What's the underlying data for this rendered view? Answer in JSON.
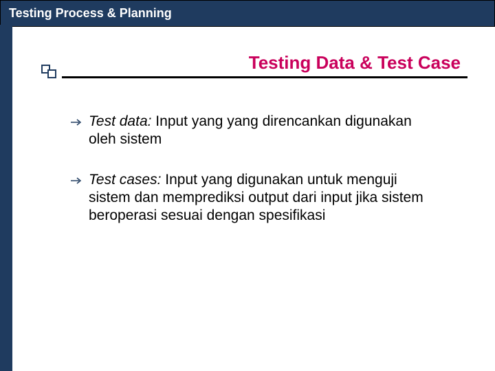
{
  "header": {
    "title": "Testing Process & Planning"
  },
  "section": {
    "title": "Testing Data & Test Case"
  },
  "bullets": [
    {
      "term": "Test data:",
      "body": "  Input yang yang direncankan digunakan oleh sistem"
    },
    {
      "term": "Test cases:",
      "body": "  Input yang digunakan untuk menguji sistem dan memprediksi output dari input jika sistem beroperasi sesuai dengan spesifikasi"
    }
  ],
  "colors": {
    "header_bg": "#1f3b5f",
    "accent": "#c9005b"
  }
}
